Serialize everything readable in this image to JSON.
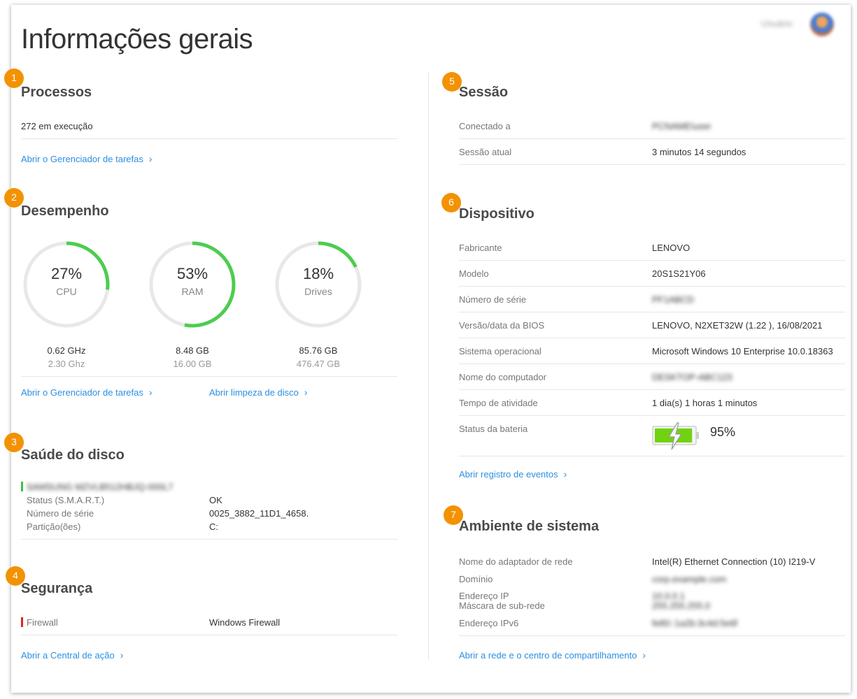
{
  "page": {
    "title": "Informações gerais"
  },
  "user": {
    "name": "Usuário"
  },
  "processos": {
    "badge": "1",
    "title": "Processos",
    "running": "272 em execução",
    "link": "Abrir o Gerenciador de tarefas"
  },
  "desempenho": {
    "badge": "2",
    "title": "Desempenho",
    "gauges": [
      {
        "percent_label": "27%",
        "percent": 27,
        "name": "CPU",
        "used": "0.62 GHz",
        "total": "2.30 Ghz"
      },
      {
        "percent_label": "53%",
        "percent": 53,
        "name": "RAM",
        "used": "8.48 GB",
        "total": "16.00 GB"
      },
      {
        "percent_label": "18%",
        "percent": 18,
        "name": "Drives",
        "used": "85.76 GB",
        "total": "476.47 GB"
      }
    ],
    "link_tasks": "Abrir o Gerenciador de tarefas",
    "link_disk": "Abrir limpeza de disco"
  },
  "saude": {
    "badge": "3",
    "title": "Saúde do disco",
    "disk_name": "SAMSUNG MZVLB512HBJQ-000L7",
    "rows": [
      {
        "label": "Status (S.M.A.R.T.)",
        "value": "OK"
      },
      {
        "label": "Número de série",
        "value": "0025_3882_11D1_4658."
      },
      {
        "label": "Partição(ões)",
        "value": "C:"
      }
    ]
  },
  "seguranca": {
    "badge": "4",
    "title": "Segurança",
    "firewall_label": "Firewall",
    "firewall_value": "Windows Firewall",
    "link": "Abrir a Central de ação"
  },
  "sessao": {
    "badge": "5",
    "title": "Sessão",
    "rows": [
      {
        "label": "Conectado a",
        "value": "PCNAME\\user"
      },
      {
        "label": "Sessão atual",
        "value": "3 minutos 14 segundos"
      }
    ]
  },
  "dispositivo": {
    "badge": "6",
    "title": "Dispositivo",
    "rows": [
      {
        "label": "Fabricante",
        "value": "LENOVO"
      },
      {
        "label": "Modelo",
        "value": "20S1S21Y06"
      },
      {
        "label": "Número de série",
        "value": "PF1ABCD"
      },
      {
        "label": "Versão/data da BIOS",
        "value": "LENOVO, N2XET32W (1.22 ), 16/08/2021"
      },
      {
        "label": "Sistema operacional",
        "value": "Microsoft Windows 10 Enterprise 10.0.18363"
      },
      {
        "label": "Nome do computador",
        "value": "DESKTOP-ABC123"
      },
      {
        "label": "Tempo de atividade",
        "value": "1 dia(s) 1 horas 1 minutos"
      },
      {
        "label": "Status da bateria",
        "value": "95%"
      }
    ],
    "battery_level": 0.95,
    "link": "Abrir registro de eventos"
  },
  "ambiente": {
    "badge": "7",
    "title": "Ambiente de sistema",
    "rows": [
      {
        "label": "Nome do adaptador de rede",
        "value": "Intel(R) Ethernet Connection (10) I219-V"
      },
      {
        "label": "Domínio",
        "value": "corp.example.com"
      },
      {
        "label": "Endereço IP",
        "value": "10.0.0.1"
      },
      {
        "label": "Máscara de sub-rede",
        "value": "255.255.255.0"
      },
      {
        "label": "Endereço IPv6",
        "value": "fe80::1a2b:3c4d:5e6f"
      }
    ],
    "link": "Abrir a rede e o centro de compartilhamento"
  },
  "colors": {
    "accent": "#f39200",
    "link": "#2b8fe0",
    "gauge": "#4ccd4f",
    "track": "#e8e8e8",
    "ok": "#3ac24b",
    "alert": "#e02424"
  }
}
